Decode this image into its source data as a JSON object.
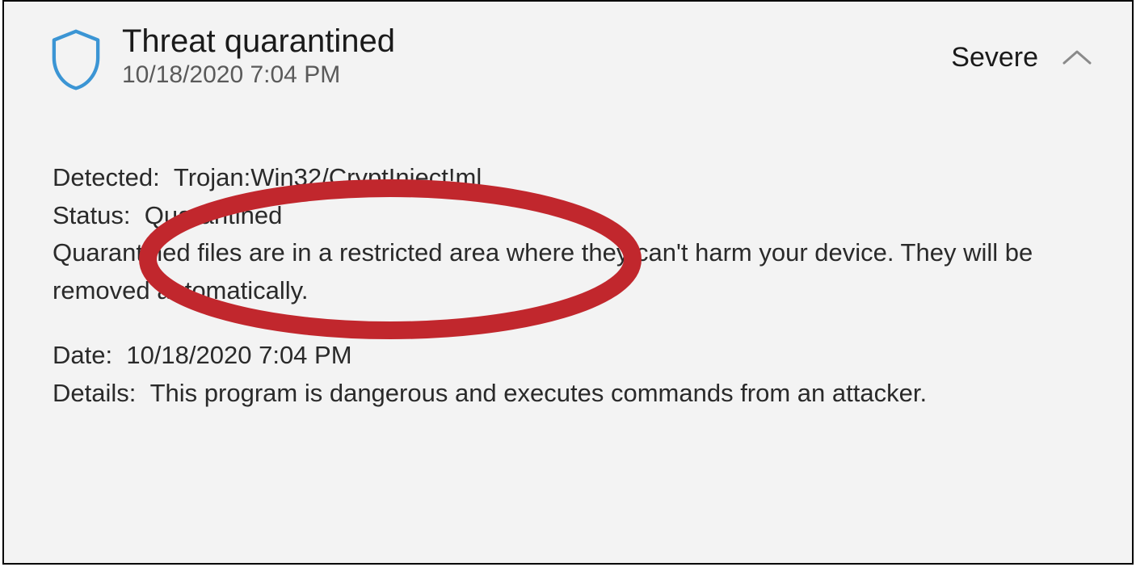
{
  "header": {
    "title": "Threat quarantined",
    "timestamp": "10/18/2020 7:04 PM",
    "severity": "Severe"
  },
  "details": {
    "detected_label": "Detected:  ",
    "detected_value": "Trojan:Win32/CryptInject!ml",
    "status_label": "Status:  ",
    "status_value": "Quarantined",
    "description": "Quarantined files are in a restricted area where they can't harm your device. They will be removed automatically.",
    "date_label": "Date:  ",
    "date_value": "10/18/2020 7:04 PM",
    "details_label": "Details:  ",
    "details_value": "This program is dangerous and executes commands from an attacker."
  },
  "annotation": {
    "color": "#c1272d"
  }
}
